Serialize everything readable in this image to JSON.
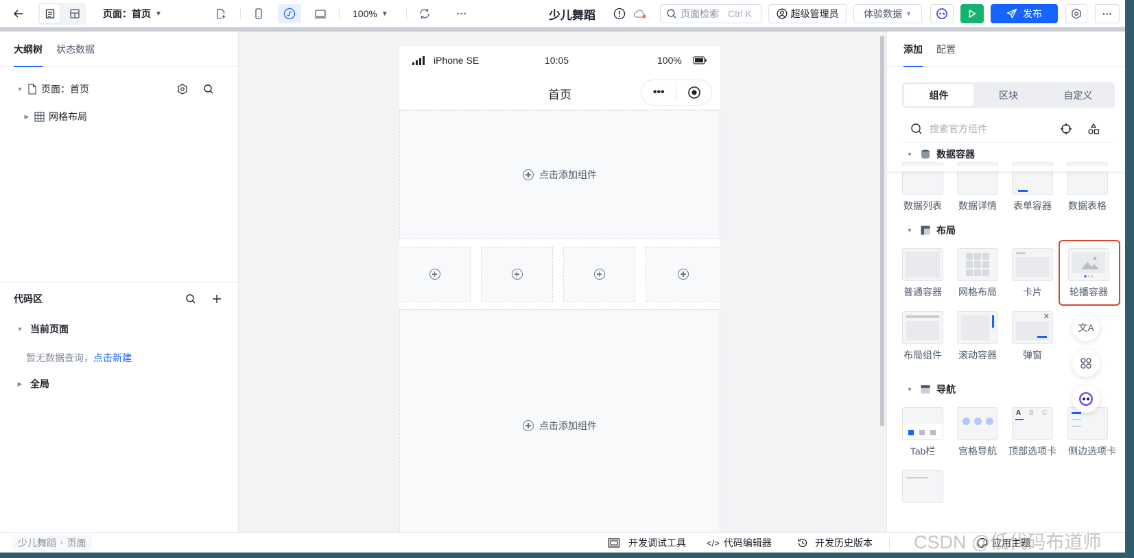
{
  "topbar": {
    "page_label": "页面：首页",
    "zoom": "100%",
    "app_name": "少儿舞蹈",
    "search_placeholder": "页面检索",
    "search_shortcut": "Ctrl K",
    "admin_label": "超级管理员",
    "data_select": "体验数据",
    "publish_label": "发布"
  },
  "left": {
    "tabs": [
      "大纲树",
      "状态数据"
    ],
    "tree": {
      "page": "页面：首页",
      "child": "网格布局"
    },
    "code": {
      "title": "代码区",
      "current_page": "当前页面",
      "empty_text": "暂无数据查询，",
      "create_link": "点击新建",
      "global": "全局"
    }
  },
  "phone": {
    "carrier": "iPhone SE",
    "time": "10:05",
    "battery": "100%",
    "nav_title": "首页",
    "add_component": "点击添加组件"
  },
  "right": {
    "tabs": [
      "添加",
      "配置"
    ],
    "segments": [
      "组件",
      "区块",
      "自定义"
    ],
    "search_placeholder": "搜索官方组件",
    "groups": {
      "data": {
        "title": "数据容器",
        "items": [
          "数据列表",
          "数据详情",
          "表单容器",
          "数据表格"
        ]
      },
      "layout": {
        "title": "布局",
        "items": [
          "普通容器",
          "网格布局",
          "卡片",
          "轮播容器",
          "布局组件",
          "滚动容器",
          "弹窗"
        ]
      },
      "nav": {
        "title": "导航",
        "items": [
          "Tab栏",
          "宫格导航",
          "顶部选项卡",
          "侧边选项卡"
        ]
      }
    },
    "highlight_color": "#d9452f"
  },
  "bottom": {
    "breadcrumb": [
      "少儿舞蹈",
      "页面"
    ],
    "tools": [
      "开发调试工具",
      "代码编辑器",
      "开发历史版本",
      "应用主题"
    ],
    "watermark": "CSDN @低代码布道师"
  },
  "colors": {
    "accent": "#1664ff",
    "run_green": "#15b371"
  }
}
